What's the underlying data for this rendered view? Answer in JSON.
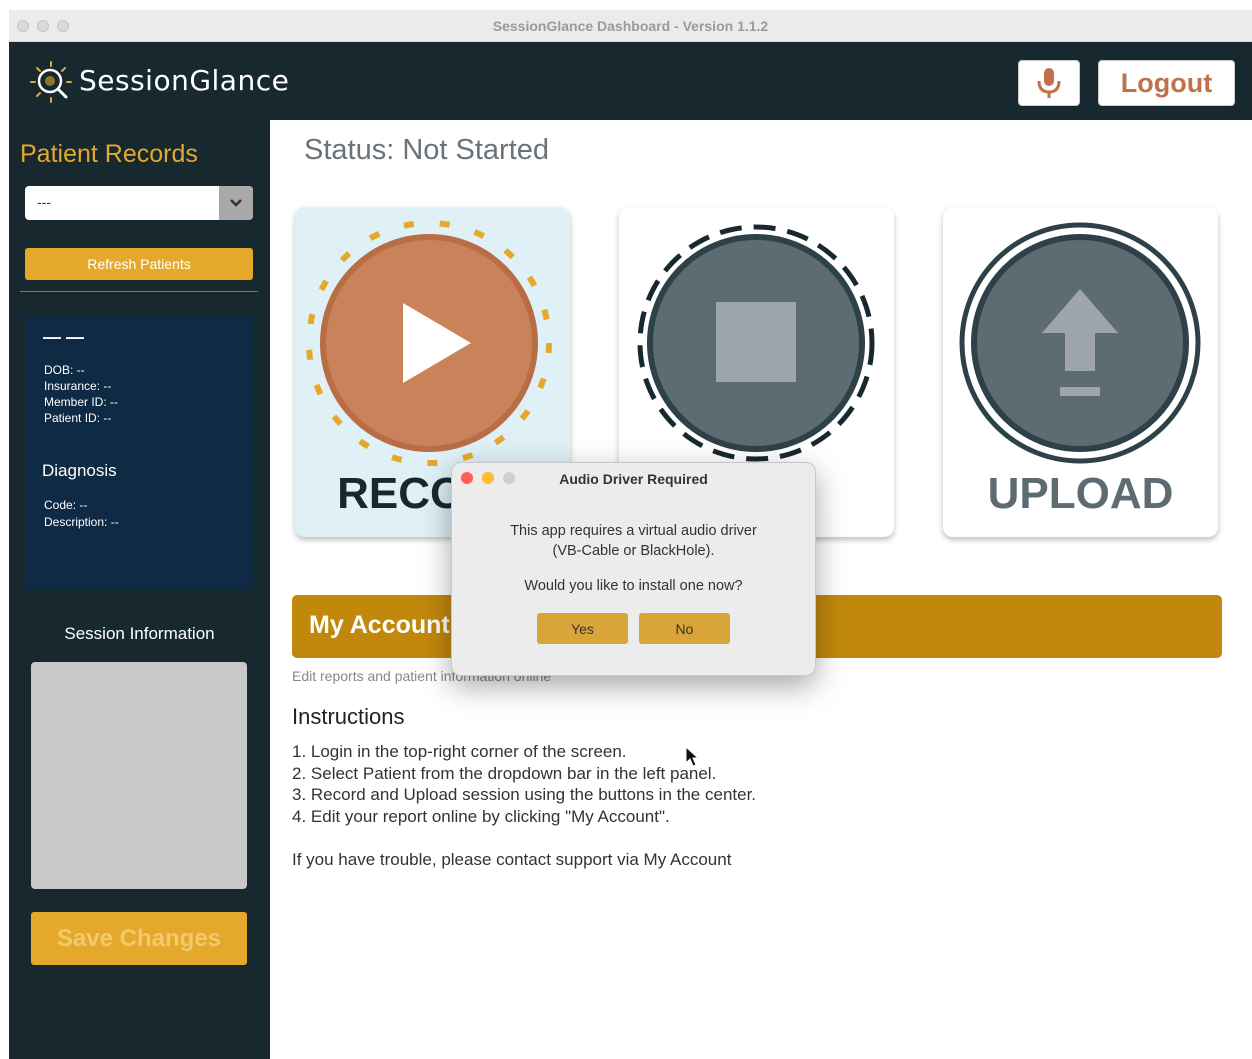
{
  "window": {
    "title": "SessionGlance Dashboard - Version 1.1.2"
  },
  "header": {
    "brand": "SessionGlance",
    "logout_label": "Logout",
    "icons": {
      "logo": "sessionglance-logo",
      "mic": "microphone-icon"
    }
  },
  "sidebar": {
    "title": "Patient Records",
    "patient_select": {
      "value": "---"
    },
    "refresh_label": "Refresh Patients",
    "patient": {
      "name": "— —",
      "dob": "DOB: --",
      "insurance": "Insurance: --",
      "member_id": "Member ID: --",
      "patient_id": "Patient ID: --"
    },
    "diagnosis": {
      "title": "Diagnosis",
      "code": "Code: --",
      "description": "Description: --"
    },
    "session_info_title": "Session Information",
    "save_label": "Save Changes"
  },
  "main": {
    "status": "Status: Not Started",
    "cards": {
      "record_label": "RECORD",
      "upload_label": "UPLOAD"
    },
    "account": {
      "label": "My Account",
      "subtitle": "Edit reports and patient information online"
    },
    "instructions": {
      "title": "Instructions",
      "steps": [
        "1. Login in the top-right corner of the screen.",
        "2. Select Patient from the dropdown bar in the left panel.",
        "3. Record and Upload session using the buttons in the center.",
        "4. Edit your report online by clicking \"My Account\"."
      ],
      "trouble": "If you have trouble, please contact support via My Account"
    }
  },
  "dialog": {
    "title": "Audio Driver Required",
    "line1": "This app requires a virtual audio driver",
    "line2": "(VB-Cable or BlackHole).",
    "question": "Would you like to install one now?",
    "yes_label": "Yes",
    "no_label": "No"
  },
  "colors": {
    "navy": "#17282f",
    "gold": "#e4a92b",
    "account_gold": "#c1880c",
    "record_orange": "#c9825a"
  }
}
